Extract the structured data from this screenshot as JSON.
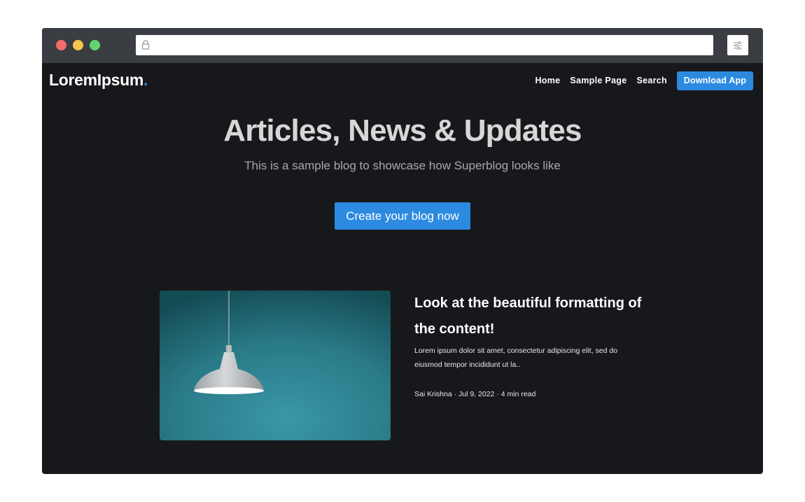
{
  "browser": {
    "url": "",
    "icons": {
      "lock": "lock-icon",
      "menu": "sliders-icon"
    },
    "traffic_light_colors": [
      "#f26d6b",
      "#f5c64f",
      "#63d471"
    ]
  },
  "nav": {
    "logo_text": "LoremIpsum",
    "logo_dot": ".",
    "links": [
      "Home",
      "Sample Page",
      "Search"
    ],
    "download_label": "Download App"
  },
  "hero": {
    "title": "Articles, News & Updates",
    "subtitle": "This is a sample blog to showcase how Superblog looks like",
    "cta_label": "Create your blog now"
  },
  "post": {
    "title": "Look at the beautiful formatting of the content!",
    "excerpt": "Lorem ipsum dolor sit amet, consectetur adipiscing elit, sed do eiusmod tempor incididunt ut la..",
    "meta": "Sai Krishna · Jul 9, 2022 · 4 min read"
  },
  "colors": {
    "accent": "#2c8ae0",
    "page_background": "#17181b",
    "browser_chrome": "#3a3e43"
  }
}
